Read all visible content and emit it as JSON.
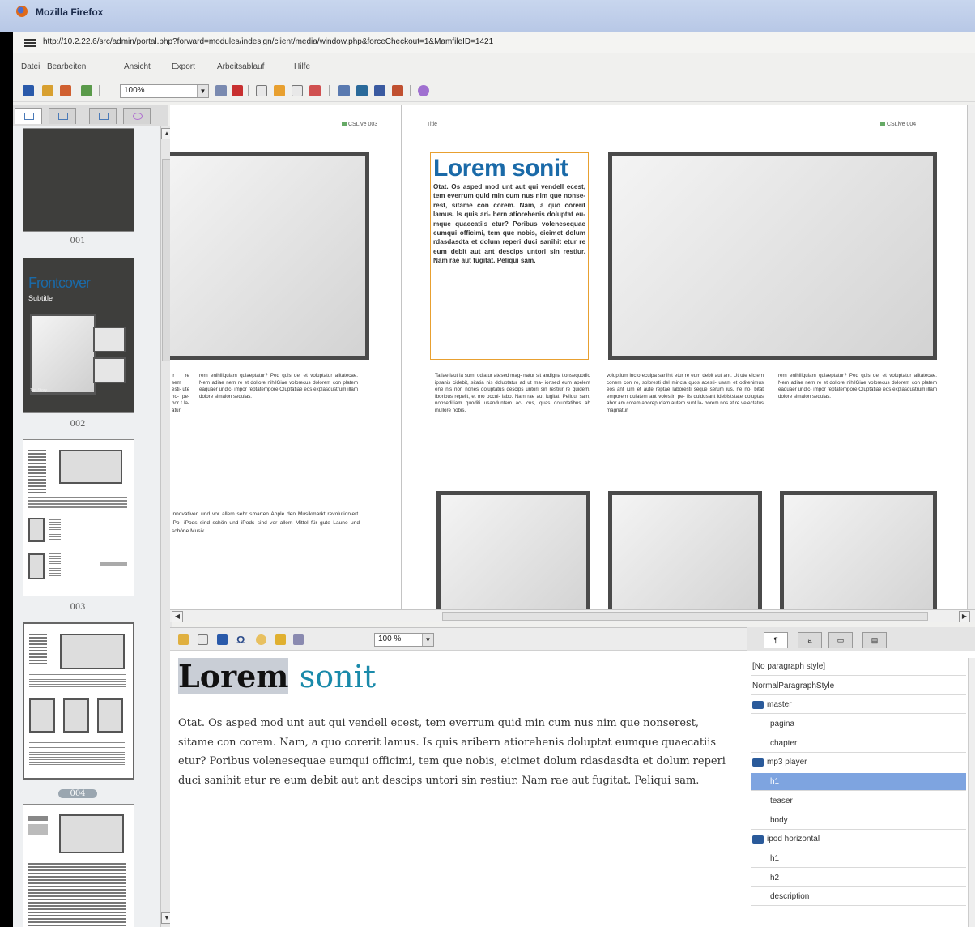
{
  "browser": {
    "title": "Mozilla Firefox",
    "url": "http://10.2.22.6/src/admin/portal.php?forward=modules/indesign/client/media/window.php&forceCheckout=1&MamfileID=1421"
  },
  "menu": [
    "Datei",
    "Bearbeiten",
    "Ansicht",
    "Export",
    "Arbeitsablauf",
    "Hilfe"
  ],
  "toolbar": {
    "zoom": "100%"
  },
  "pages_panel": {
    "thumbnails": [
      {
        "label": "001"
      },
      {
        "label": "002",
        "cover_title": "Frontcover",
        "cover_subtitle": "Subtitle",
        "cover_story": "Top Story"
      },
      {
        "label": "003"
      },
      {
        "label": "004",
        "selected": true
      }
    ]
  },
  "document": {
    "left_page": {
      "folio": "CSLive 003",
      "col1_fragment": "ir re sem esti- ute no- pe- bor t la- atur",
      "col2": "rem enihiliquiam quiaeptatur? Ped quis del et voluptatur alitatecae. Nem adiae nem re et dollore nihilGiae volorecus dolorem con platem eaquaer undic- impor reptatempore Oluptatiae eos explasdustrum illam dolore simaion sequias.",
      "bottom_text": "innovativen und vor allem sehr smarten Apple den Musikmarkt revolutioniert. iPo- iPods sind schön und iPods sind vor allem Mittel für gute Laune und schöne Musik."
    },
    "right_page": {
      "label": "Title",
      "folio": "CSLive 004",
      "heading": "Lorem sonit",
      "body": "Otat. Os asped mod unt aut qui vendell ecest, tem everrum quid min cum nus nim que nonse- rest, sitame con corem. Nam, a quo corerit lamus. Is quis ari- bern atiorehenis doluptat eu- mque quaecatiis etur? Poribus volenesequae eumqui officimi, tem que nobis, eicimet dolum rdasdasdta et dolum reperi duci sanihit etur re eum debit aut ant descips untori sin restiur. Nam rae aut fugitat. Peliqui sam.",
      "col1": "Tatiae laut la sum, odiatur atesed mag- natur sit andigna tionsequodio ipsanis cidebit, sitatia nis doluptatur ad ut ma- ionsed eum apelent ene nis non nones doluptatus descips untori sin restiur re quidem. Iboribus repelit, et mo occul- labo. Nam rae aut fugitat. Peliqui sam, nonseditiam quoditi usanduntem ac- cus, quas doluptatibus ab inullore nobis.",
      "col2": "voluptium inctoreculpa sanihit etur re eum debit aut ant. Ut ute eictem conem con re, soloresti del mincta quos acesti- usam et oditenimus eos ant ium et aute reptae laboresti seque serum ius, ne no- bitat emporem quiatem aut volestin pe- lis quidusant idebiststate doluptas abor am corem aborepudam autem sunt la- borem nos et re velectatus magnatur",
      "col3": "rem enihiliquiam quiaeptatur? Ped quis del et voluptatur alitatecae. Nem adiae nem re et dollore nihilGiae volorecus dolorem con platem eaquaer undic- impor reptatempore Oluptatiae eos explasdustrum illam dolore simaion sequias."
    }
  },
  "editor": {
    "zoom": "100 %",
    "heading_word1": "Lorem",
    "heading_word2": "sonit",
    "body": "Otat. Os asped mod unt aut qui vendell ecest, tem everrum quid min cum nus nim que nonserest, sitame con corem. Nam, a quo corerit lamus. Is quis aribern atiorehenis doluptat eumque quaecatiis etur? Poribus volenesequae eumqui officimi, tem que nobis, eicimet dolum rdasdasdta et dolum reperi duci sanihit etur re eum debit aut ant descips untori sin restiur. Nam rae aut fugitat. Peliqui sam."
  },
  "styles_panel": {
    "items": [
      {
        "label": "[No paragraph style]",
        "kind": "plain"
      },
      {
        "label": "NormalParagraphStyle",
        "kind": "plain"
      },
      {
        "label": "master",
        "kind": "group"
      },
      {
        "label": "pagina",
        "kind": "child"
      },
      {
        "label": "chapter",
        "kind": "child"
      },
      {
        "label": "mp3 player",
        "kind": "group"
      },
      {
        "label": "h1",
        "kind": "child",
        "selected": true
      },
      {
        "label": "teaser",
        "kind": "child"
      },
      {
        "label": "body",
        "kind": "child"
      },
      {
        "label": "ipod horizontal",
        "kind": "group"
      },
      {
        "label": "h1",
        "kind": "child"
      },
      {
        "label": "h2",
        "kind": "child"
      },
      {
        "label": "description",
        "kind": "child"
      }
    ]
  }
}
